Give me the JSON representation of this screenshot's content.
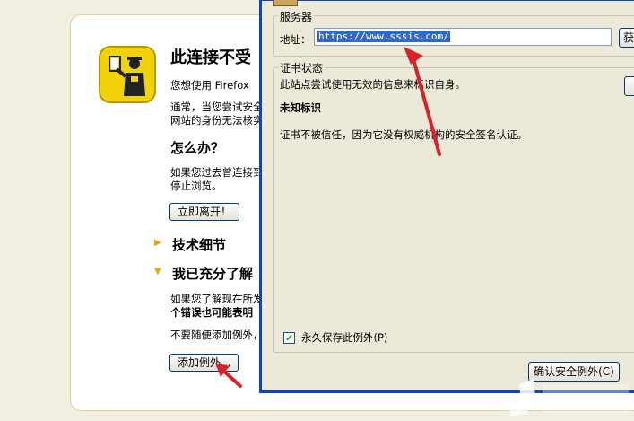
{
  "page": {
    "title": "此连接不受",
    "line1": "您想使用 Firefox",
    "line2": "通常，当您尝试安全",
    "line3": "网站的身份无法核实",
    "what_todo": "怎么办？",
    "line4": "如果您过去曾连接到",
    "line5": "停止浏览。",
    "leave_button": "立即离开！",
    "tech_details": "技术细节",
    "understand_risks": "我已充分了解",
    "line6": "如果您了解现在所发",
    "line7": "个错误也可能表明",
    "line8": "不要随便添加例外，",
    "add_exception_button": "添加例外..."
  },
  "dialog": {
    "server_group": "服务器",
    "address_label": "地址：",
    "address_value": "https://www.sssis.com/",
    "fetch_button": "获",
    "cert_group": "证书状态",
    "cert_line": "此站点尝试使用无效的信息来标识自身。",
    "unknown_identity": "未知标识",
    "unknown_desc": "证书不被信任，因为它没有权威机构的安全签名认证。",
    "permanent_label": "永久保存此例外(P)",
    "permanent_checked": true,
    "confirm_button": "确认安全例外(C)"
  },
  "colors": {
    "dialog_border": "#0a45c7",
    "arrow": "#d8222a",
    "icon_bg": "#f2d20a"
  }
}
